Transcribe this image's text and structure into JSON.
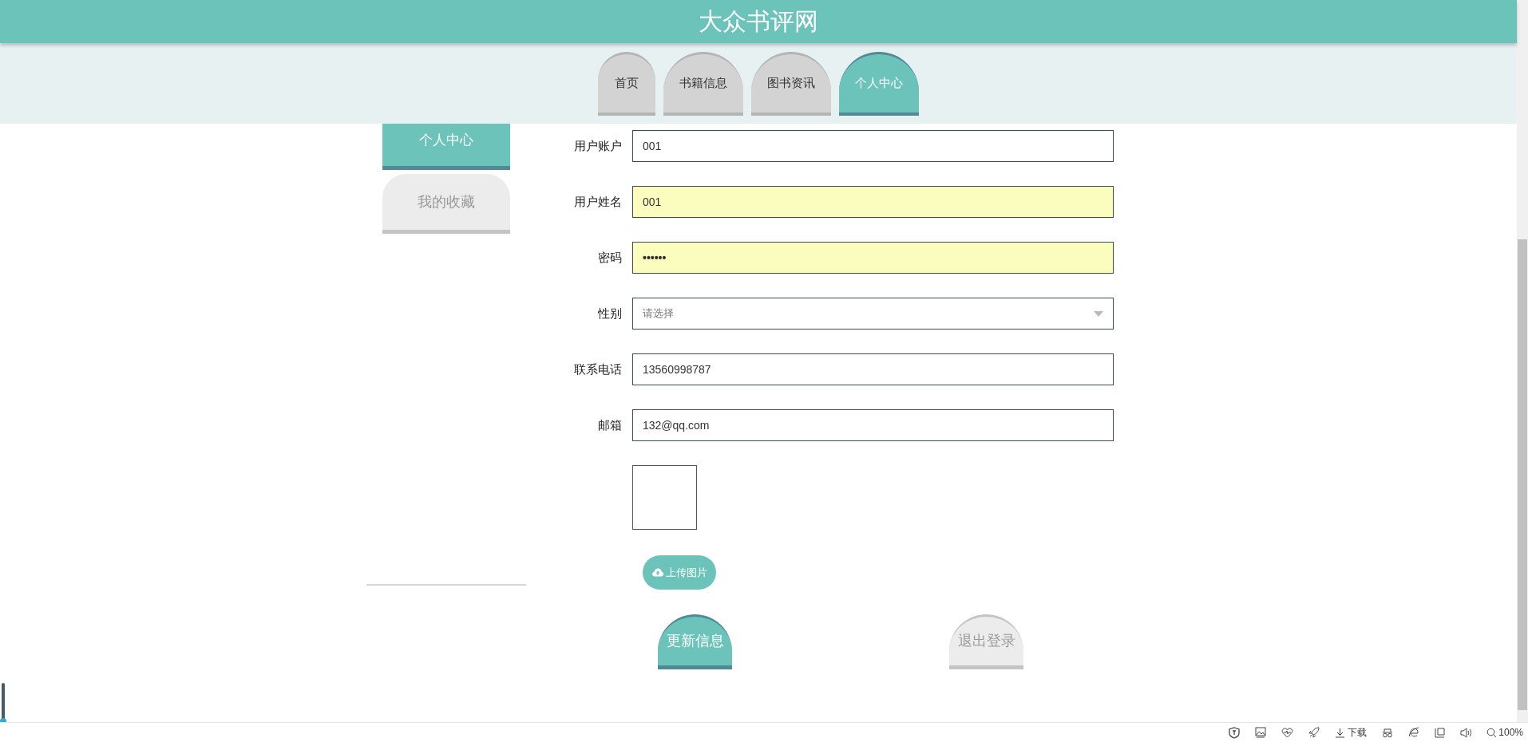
{
  "site_title": "大众书评网",
  "nav_tabs": [
    {
      "label": "首页",
      "selected": false
    },
    {
      "label": "书籍信息",
      "selected": false
    },
    {
      "label": "图书资讯",
      "selected": false
    },
    {
      "label": "个人中心",
      "selected": true
    }
  ],
  "sidebar": {
    "items": [
      {
        "label": "个人中心",
        "selected": true
      },
      {
        "label": "我的收藏",
        "selected": false
      }
    ]
  },
  "form": {
    "fields": [
      {
        "kind": "text",
        "label": "用户账户",
        "value": "001",
        "autofilled": false
      },
      {
        "kind": "text",
        "label": "用户姓名",
        "value": "001",
        "autofilled": true
      },
      {
        "kind": "password",
        "label": "密码",
        "value": "••••••",
        "autofilled": true
      },
      {
        "kind": "select",
        "label": "性别",
        "placeholder": "请选择",
        "autofilled": false
      },
      {
        "kind": "text",
        "label": "联系电话",
        "value": "13560998787",
        "autofilled": false
      },
      {
        "kind": "text",
        "label": "邮箱",
        "value": "132@qq.com",
        "autofilled": false
      },
      {
        "kind": "image"
      }
    ],
    "upload_button": "上传图片",
    "buttons": [
      {
        "label": "更新信息",
        "primary": true
      },
      {
        "label": "退出登录",
        "primary": false
      }
    ]
  },
  "status_bar": {
    "download": "下载",
    "zoom": "100%"
  }
}
